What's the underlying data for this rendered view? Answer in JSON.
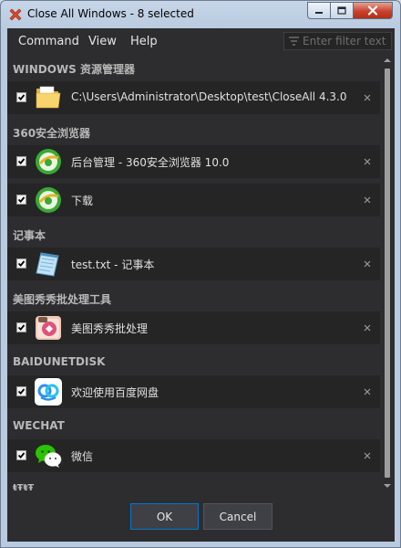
{
  "window": {
    "title": "Close All Windows - 8 selected"
  },
  "menu": {
    "command": "Command",
    "view": "View",
    "help": "Help"
  },
  "filter": {
    "placeholder": "Enter filter text"
  },
  "groups": [
    {
      "title": "WINDOWS 资源管理器"
    },
    {
      "title": "360安全浏览器"
    },
    {
      "title": "记事本"
    },
    {
      "title": "美图秀秀批处理工具"
    },
    {
      "title": "BAIDUNETDISK"
    },
    {
      "title": "WECHAT"
    },
    {
      "title": "ŧŦŧŦ"
    }
  ],
  "items": [
    {
      "label": "C:\\Users\\Administrator\\Desktop\\test\\CloseAll 4.3.0",
      "checked": true,
      "icon": "folder-icon"
    },
    {
      "label": "后台管理 - 360安全浏览器 10.0",
      "checked": true,
      "icon": "browser-360-icon"
    },
    {
      "label": "下载",
      "checked": true,
      "icon": "browser-360-icon"
    },
    {
      "label": "test.txt - 记事本",
      "checked": true,
      "icon": "notepad-icon"
    },
    {
      "label": "美图秀秀批处理",
      "checked": true,
      "icon": "meitu-icon"
    },
    {
      "label": "欢迎使用百度网盘",
      "checked": true,
      "icon": "baidu-netdisk-icon"
    },
    {
      "label": "微信",
      "checked": true,
      "icon": "wechat-icon"
    }
  ],
  "buttons": {
    "ok": "OK",
    "cancel": "Cancel"
  },
  "colors": {
    "background": "#2d2d30",
    "row": "#252526",
    "text": "#e0e0e0",
    "ok_border": "#007acc"
  }
}
